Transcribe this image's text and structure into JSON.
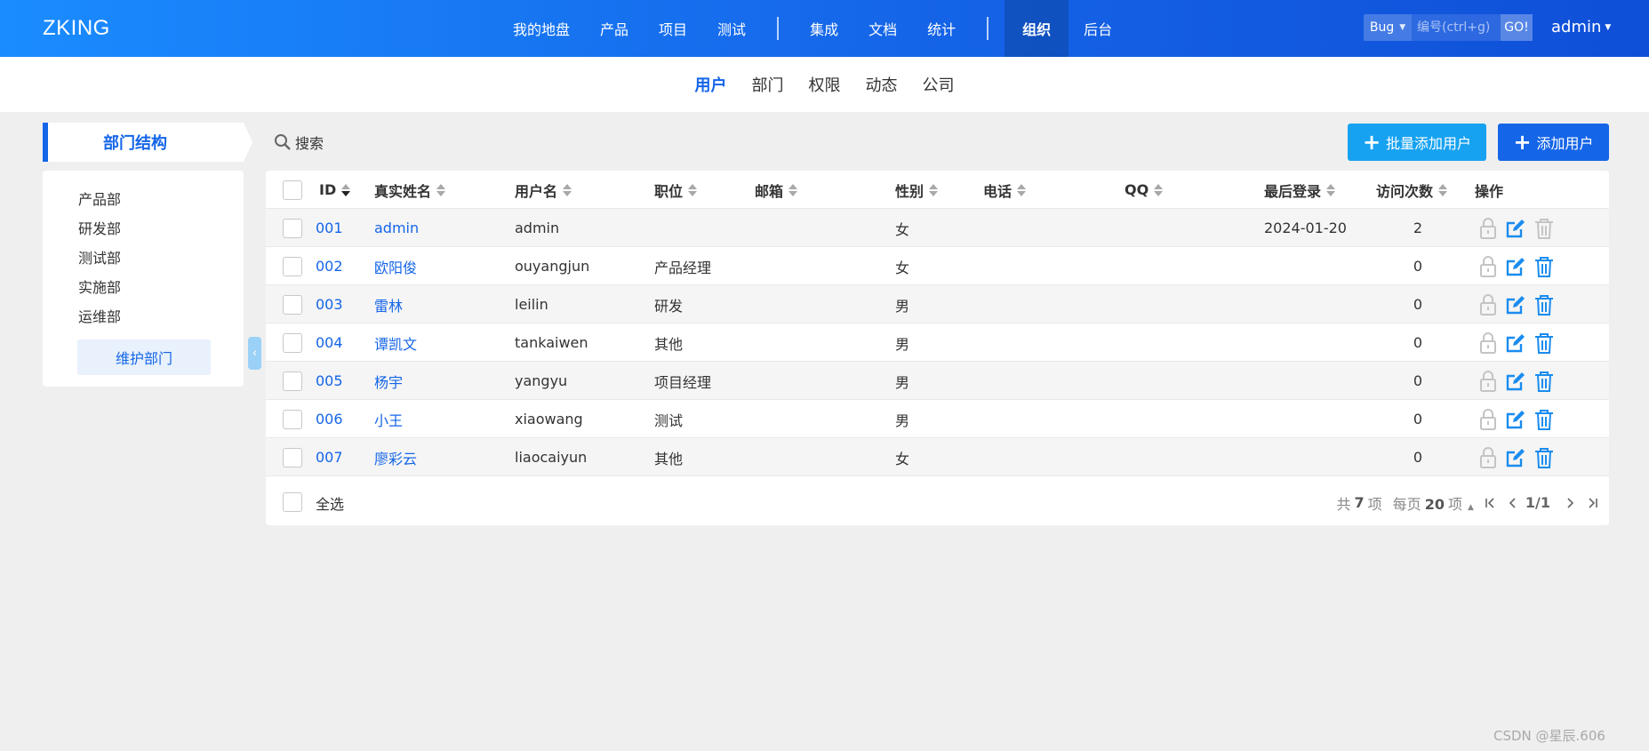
{
  "header": {
    "brand": "ZKING",
    "nav": [
      "我的地盘",
      "产品",
      "项目",
      "测试",
      "集成",
      "文档",
      "统计",
      "组织",
      "后台"
    ],
    "active_nav": "组织",
    "quick_type": "Bug",
    "quick_placeholder": "编号(ctrl+g)",
    "go_label": "GO!",
    "user": "admin"
  },
  "subnav": {
    "items": [
      "用户",
      "部门",
      "权限",
      "动态",
      "公司"
    ],
    "active": "用户"
  },
  "sidebar": {
    "title": "部门结构",
    "departments": [
      "产品部",
      "研发部",
      "测试部",
      "实施部",
      "运维部"
    ],
    "maintain_label": "维护部门"
  },
  "toolbar": {
    "search_label": "搜索",
    "batch_add_label": "批量添加用户",
    "add_label": "添加用户"
  },
  "table": {
    "headers": {
      "id": "ID",
      "realname": "真实姓名",
      "username": "用户名",
      "role": "职位",
      "email": "邮箱",
      "gender": "性别",
      "phone": "电话",
      "qq": "QQ",
      "last_login": "最后登录",
      "visits": "访问次数",
      "actions": "操作"
    },
    "rows": [
      {
        "id": "001",
        "realname": "admin",
        "username": "admin",
        "role": "",
        "gender": "女",
        "last_login": "2024-01-20",
        "visits": "2"
      },
      {
        "id": "002",
        "realname": "欧阳俊",
        "username": "ouyangjun",
        "role": "产品经理",
        "gender": "女",
        "last_login": "",
        "visits": "0"
      },
      {
        "id": "003",
        "realname": "雷林",
        "username": "leilin",
        "role": "研发",
        "gender": "男",
        "last_login": "",
        "visits": "0"
      },
      {
        "id": "004",
        "realname": "谭凯文",
        "username": "tankaiwen",
        "role": "其他",
        "gender": "男",
        "last_login": "",
        "visits": "0"
      },
      {
        "id": "005",
        "realname": "杨宇",
        "username": "yangyu",
        "role": "项目经理",
        "gender": "男",
        "last_login": "",
        "visits": "0"
      },
      {
        "id": "006",
        "realname": "小王",
        "username": "xiaowang",
        "role": "测试",
        "gender": "男",
        "last_login": "",
        "visits": "0"
      },
      {
        "id": "007",
        "realname": "廖彩云",
        "username": "liaocaiyun",
        "role": "其他",
        "gender": "女",
        "last_login": "",
        "visits": "0"
      }
    ],
    "select_all_label": "全选"
  },
  "pager": {
    "total_prefix": "共",
    "total": "7",
    "total_suffix": "项",
    "per_page_prefix": "每页",
    "per_page": "20",
    "per_page_suffix": "项",
    "page": "1/1"
  },
  "watermark": "CSDN @星辰.606",
  "colors": {
    "primary": "#1565e8",
    "accent": "#17a2f1"
  }
}
